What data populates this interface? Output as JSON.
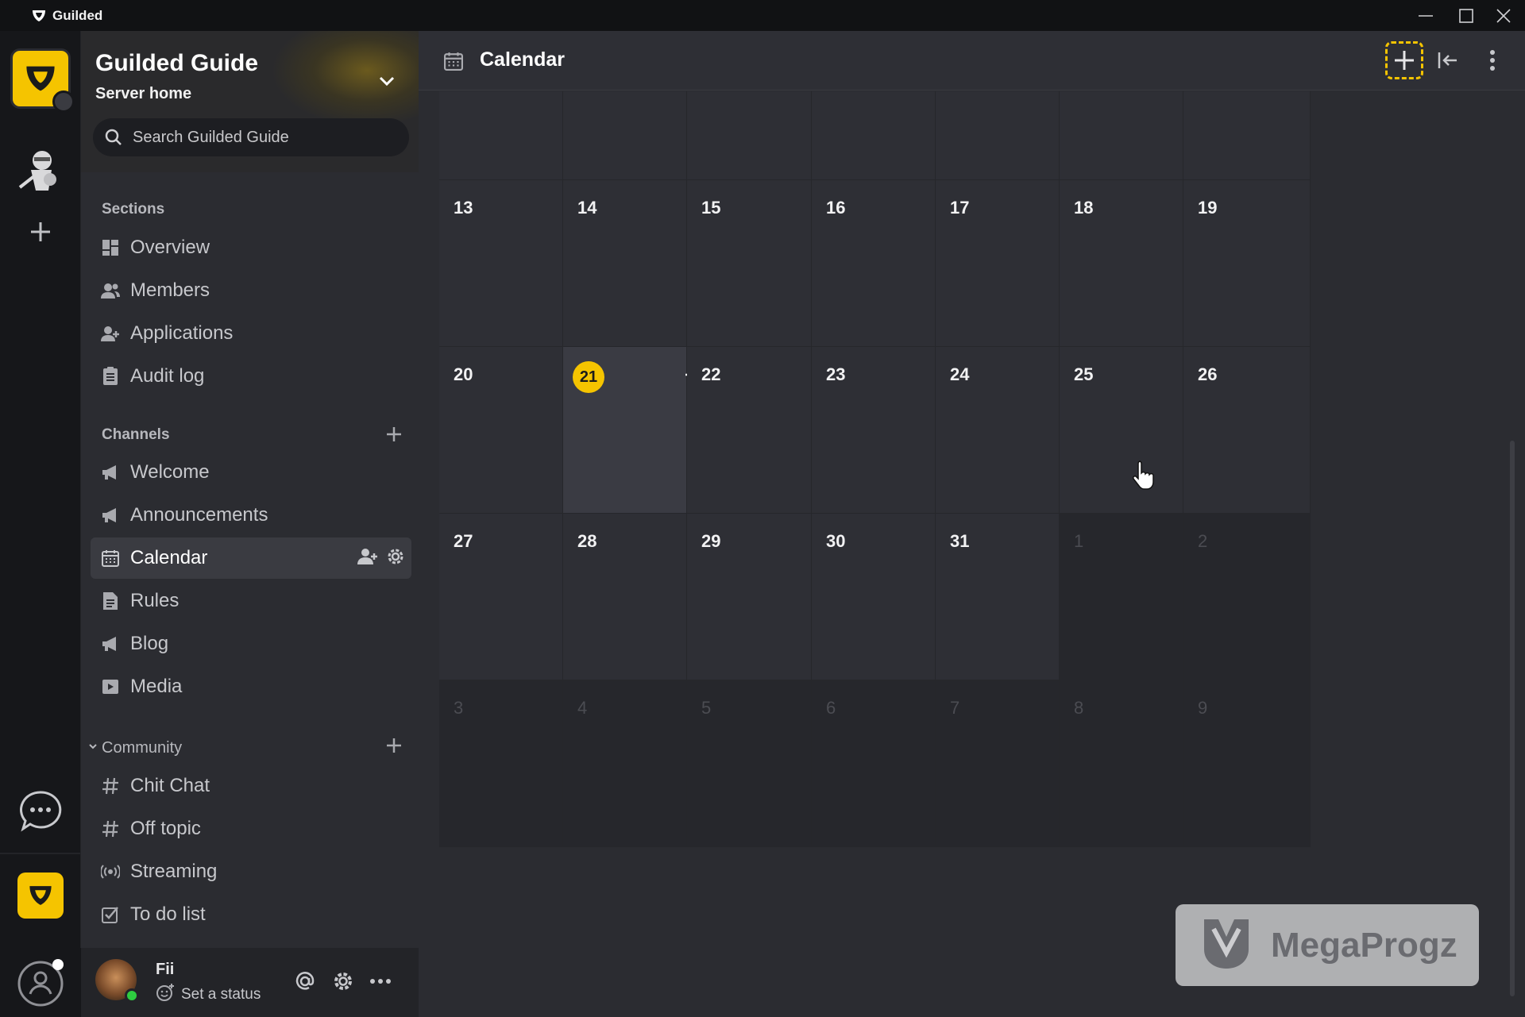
{
  "window": {
    "app_title": "Guilded"
  },
  "server": {
    "name": "Guilded Guide",
    "subtitle": "Server home",
    "search_placeholder": "Search Guilded Guide"
  },
  "sections": {
    "label": "Sections",
    "items": [
      {
        "label": "Overview",
        "icon": "overview-icon"
      },
      {
        "label": "Members",
        "icon": "members-icon"
      },
      {
        "label": "Applications",
        "icon": "applications-icon"
      },
      {
        "label": "Audit log",
        "icon": "audit-log-icon"
      }
    ]
  },
  "channels": {
    "label": "Channels",
    "items": [
      {
        "label": "Welcome",
        "icon": "announcement-icon"
      },
      {
        "label": "Announcements",
        "icon": "announcement-icon"
      },
      {
        "label": "Calendar",
        "icon": "calendar-icon",
        "active": true
      },
      {
        "label": "Rules",
        "icon": "doc-icon"
      },
      {
        "label": "Blog",
        "icon": "announcement-icon"
      },
      {
        "label": "Media",
        "icon": "media-icon"
      }
    ]
  },
  "community": {
    "label": "Community",
    "items": [
      {
        "label": "Chit Chat",
        "icon": "hash-icon"
      },
      {
        "label": "Off topic",
        "icon": "hash-icon"
      },
      {
        "label": "Streaming",
        "icon": "stream-icon"
      },
      {
        "label": "To do list",
        "icon": "checklist-icon"
      }
    ]
  },
  "user": {
    "name": "Fii",
    "status_text": "Set a status",
    "presence": "online"
  },
  "main": {
    "title": "Calendar"
  },
  "calendar": {
    "today": "21",
    "weeks": [
      [
        {
          "d": "",
          "dim": false
        },
        {
          "d": "",
          "dim": false
        },
        {
          "d": "",
          "dim": false
        },
        {
          "d": "",
          "dim": false
        },
        {
          "d": "",
          "dim": false
        },
        {
          "d": "",
          "dim": false
        },
        {
          "d": "",
          "dim": false
        }
      ],
      [
        {
          "d": "13",
          "dim": false
        },
        {
          "d": "14",
          "dim": false
        },
        {
          "d": "15",
          "dim": false
        },
        {
          "d": "16",
          "dim": false
        },
        {
          "d": "17",
          "dim": false
        },
        {
          "d": "18",
          "dim": false
        },
        {
          "d": "19",
          "dim": false
        }
      ],
      [
        {
          "d": "20",
          "dim": false
        },
        {
          "d": "21",
          "dim": false,
          "today": true
        },
        {
          "d": "22",
          "dim": false
        },
        {
          "d": "23",
          "dim": false
        },
        {
          "d": "24",
          "dim": false
        },
        {
          "d": "25",
          "dim": false
        },
        {
          "d": "26",
          "dim": false
        }
      ],
      [
        {
          "d": "27",
          "dim": false
        },
        {
          "d": "28",
          "dim": false
        },
        {
          "d": "29",
          "dim": false
        },
        {
          "d": "30",
          "dim": false
        },
        {
          "d": "31",
          "dim": false
        },
        {
          "d": "1",
          "dim": true
        },
        {
          "d": "2",
          "dim": true
        }
      ],
      [
        {
          "d": "3",
          "dim": true
        },
        {
          "d": "4",
          "dim": true
        },
        {
          "d": "5",
          "dim": true
        },
        {
          "d": "6",
          "dim": true
        },
        {
          "d": "7",
          "dim": true
        },
        {
          "d": "8",
          "dim": true
        },
        {
          "d": "9",
          "dim": true
        }
      ]
    ]
  },
  "watermark": {
    "text": "MegaProgz"
  },
  "colors": {
    "accent": "#f5c400",
    "bg_main": "#2b2c31",
    "bg_rail": "#16171a"
  }
}
